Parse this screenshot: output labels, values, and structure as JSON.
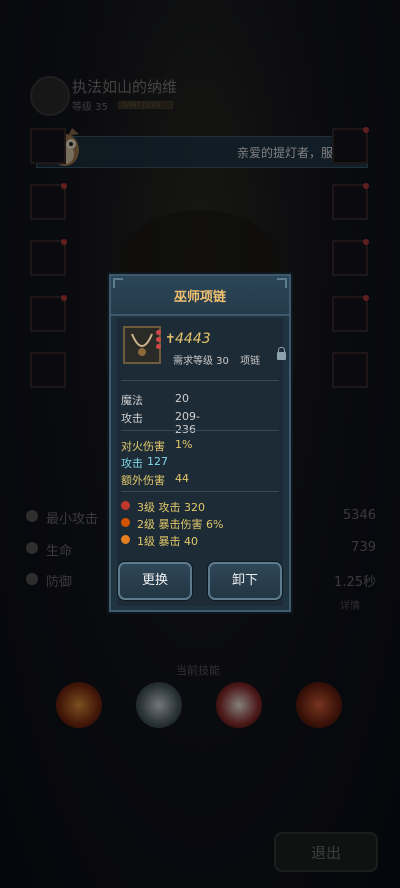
{
  "hero": {
    "name": "执法如山的纳维",
    "level": "等级 35",
    "bar_text": "0/867 (3/10)"
  },
  "banner": {
    "text": "亲爱的提灯者，服务"
  },
  "stats": [
    {
      "label": "最小攻击",
      "value": "5346"
    },
    {
      "label": "生命",
      "value": "739"
    },
    {
      "label": "防御",
      "value": "1.25秒"
    }
  ],
  "detail_label": "详情",
  "skills_title": "当前技能",
  "exit_label": "退出",
  "modal": {
    "title": "巫师项链",
    "power": "4443",
    "requirement": "需求等级 30",
    "slot_type": "项链",
    "base_stats": [
      {
        "label": "魔法",
        "value": "20"
      },
      {
        "label": "攻击",
        "value": "209-236"
      }
    ],
    "extra_stats": [
      {
        "label": "对火伤害",
        "value": "1%"
      },
      {
        "label": "攻击",
        "value": "127"
      },
      {
        "label": "额外伤害",
        "value": "44"
      }
    ],
    "gems": [
      {
        "text": "3级 攻击 320",
        "color": "#c0392b"
      },
      {
        "text": "2级 暴击伤害 6%",
        "color": "#d35400"
      },
      {
        "text": "1级 暴击 40",
        "color": "#e67e22"
      }
    ],
    "replace_label": "更换",
    "unequip_label": "卸下"
  }
}
